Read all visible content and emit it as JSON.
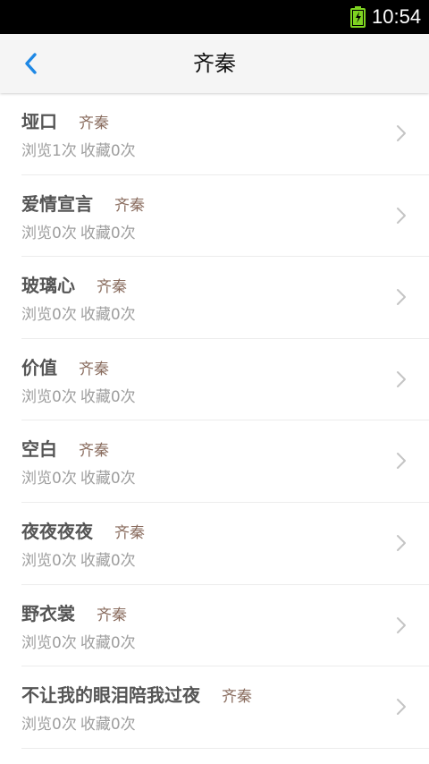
{
  "status_bar": {
    "time": "10:54",
    "battery_color": "#7ed321"
  },
  "header": {
    "title": "齐秦",
    "back_icon": "chevron-left-icon",
    "accent": "#1e88e5"
  },
  "songs": [
    {
      "title": "垭口",
      "artist": "齐秦",
      "views": "浏览1次",
      "favorites": "收藏0次"
    },
    {
      "title": "爱情宣言",
      "artist": "齐秦",
      "views": "浏览0次",
      "favorites": "收藏0次"
    },
    {
      "title": "玻璃心",
      "artist": "齐秦",
      "views": "浏览0次",
      "favorites": "收藏0次"
    },
    {
      "title": "价值",
      "artist": "齐秦",
      "views": "浏览0次",
      "favorites": "收藏0次"
    },
    {
      "title": "空白",
      "artist": "齐秦",
      "views": "浏览0次",
      "favorites": "收藏0次"
    },
    {
      "title": "夜夜夜夜",
      "artist": "齐秦",
      "views": "浏览0次",
      "favorites": "收藏0次"
    },
    {
      "title": "野衣裳",
      "artist": "齐秦",
      "views": "浏览0次",
      "favorites": "收藏0次"
    },
    {
      "title": "不让我的眼泪陪我过夜",
      "artist": "齐秦",
      "views": "浏览0次",
      "favorites": "收藏0次"
    }
  ]
}
